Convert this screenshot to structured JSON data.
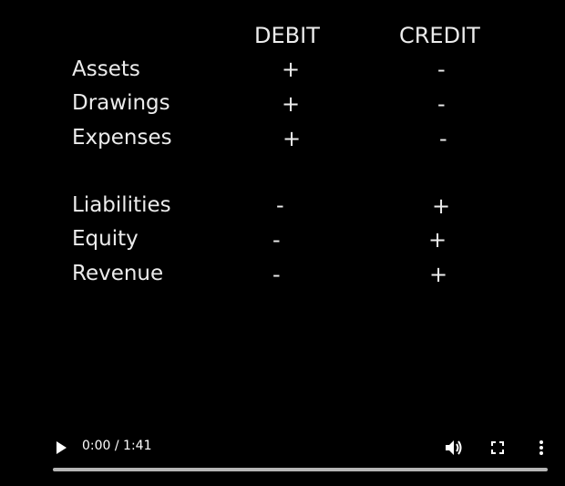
{
  "headers": {
    "debit": "DEBIT",
    "credit": "CREDIT"
  },
  "rows": [
    {
      "account": "Assets",
      "debit": "+",
      "credit": "-"
    },
    {
      "account": "Drawings",
      "debit": "+",
      "credit": "-"
    },
    {
      "account": "Expenses",
      "debit": "+",
      "credit": "-"
    },
    {
      "account": "Liabilities",
      "debit": "-",
      "credit": "+"
    },
    {
      "account": "Equity",
      "debit": "-",
      "credit": "+"
    },
    {
      "account": "Revenue",
      "debit": "-",
      "credit": "+"
    }
  ],
  "player": {
    "time": "0:00 / 1:41",
    "progress": 0,
    "icons": {
      "play": "play-icon",
      "volume": "volume-icon",
      "fullscreen": "fullscreen-icon",
      "more": "more-options-icon"
    }
  }
}
